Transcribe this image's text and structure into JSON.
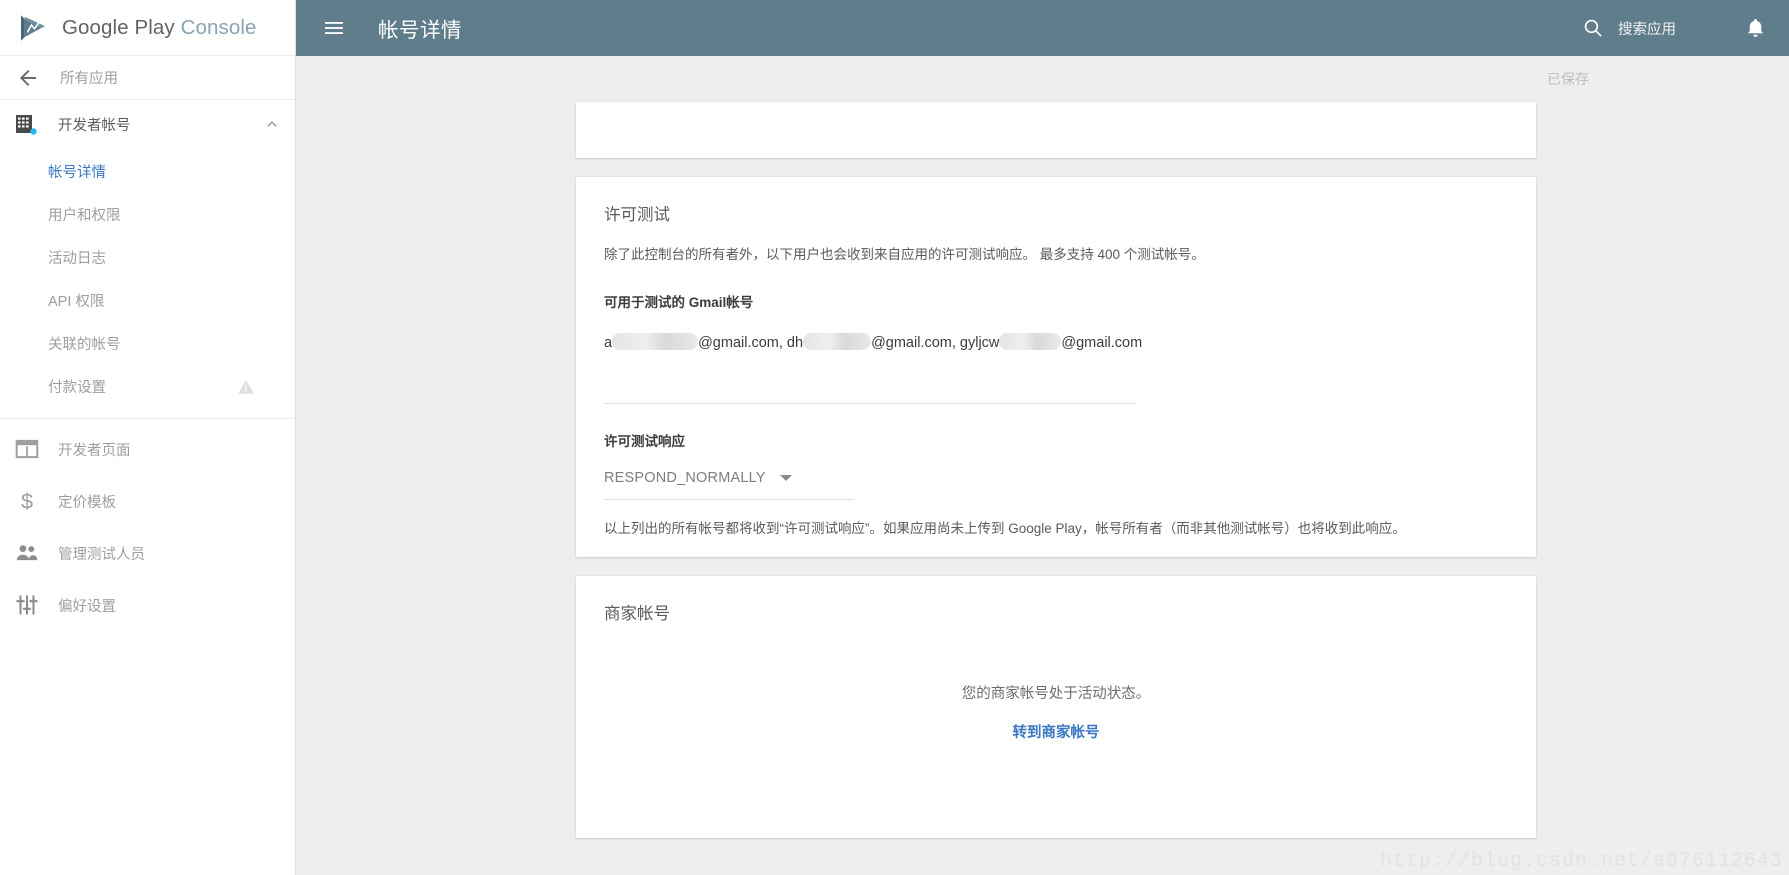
{
  "brand": {
    "word1": "Google Play",
    "word2": "Console",
    "logo_icon": "google-play-logo-icon"
  },
  "topbar": {
    "menu_icon": "hamburger-menu-icon",
    "title": "帐号详情",
    "search_icon": "search-icon",
    "search_label": "搜索应用",
    "notifications_icon": "bell-icon",
    "background_color": "#607d8b"
  },
  "sidebar": {
    "back": {
      "label": "所有应用",
      "icon": "arrow-left-icon"
    },
    "group": {
      "label": "开发者帐号",
      "icon": "developer-account-building-icon",
      "chevron_icon": "chevron-up-icon",
      "expanded": true
    },
    "sub_items": [
      {
        "label": "帐号详情",
        "active": true
      },
      {
        "label": "用户和权限",
        "active": false
      },
      {
        "label": "活动日志",
        "active": false
      },
      {
        "label": "API 权限",
        "active": false
      },
      {
        "label": "关联的帐号",
        "active": false
      },
      {
        "label": "付款设置",
        "active": false,
        "warning_icon": "warning-triangle-icon"
      }
    ],
    "items": [
      {
        "label": "开发者页面",
        "icon": "developer-page-icon"
      },
      {
        "label": "定价模板",
        "icon": "dollar-sign-icon"
      },
      {
        "label": "管理测试人员",
        "icon": "people-group-icon"
      },
      {
        "label": "偏好设置",
        "icon": "preferences-sliders-icon"
      }
    ],
    "active_color": "#3b78c3"
  },
  "main": {
    "save_status": "已保存",
    "license_card": {
      "title": "许可测试",
      "description": "除了此控制台的所有者外，以下用户也会收到来自应用的许可测试响应。 最多支持 400 个测试帐号。",
      "gmail_label": "可用于测试的 Gmail帐号",
      "emails": {
        "prefix_1": "a",
        "suffix_1": "@gmail.com, dh",
        "suffix_2": "@gmail.com, gyljcw",
        "suffix_3": "@gmail.com"
      },
      "response_label": "许可测试响应",
      "response_value": "RESPOND_NORMALLY",
      "response_dropdown_icon": "chevron-down-icon",
      "response_options": [
        "RESPOND_NORMALLY"
      ],
      "note": "以上列出的所有帐号都将收到“许可测试响应”。如果应用尚未上传到 Google Play，帐号所有者（而非其他测试帐号）也将收到此响应。"
    },
    "merchant_card": {
      "title": "商家帐号",
      "status": "您的商家帐号处于活动状态。",
      "link_label": "转到商家帐号"
    }
  },
  "watermark": {
    "text": "http://blog.csdn.net/a976112643"
  }
}
